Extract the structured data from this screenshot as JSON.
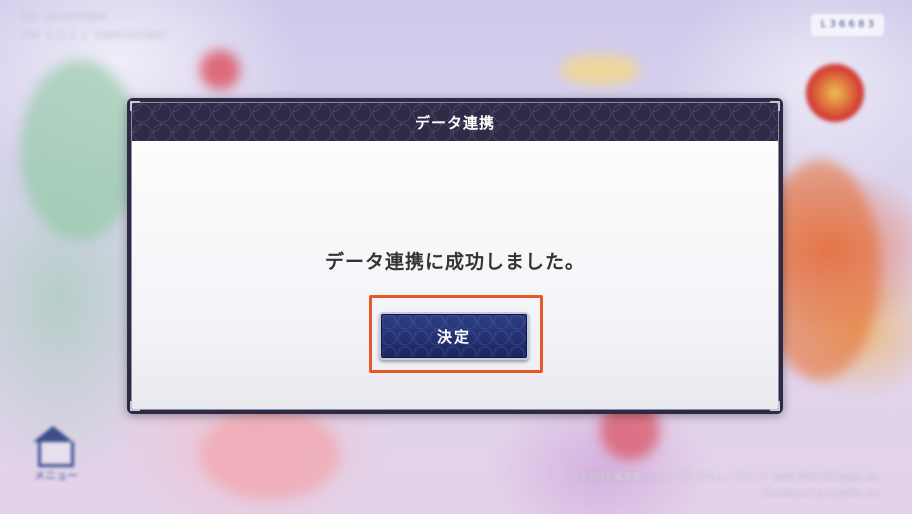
{
  "background": {
    "user_id": "ID: 6132078866",
    "version": "ver 1.2.1 / 118011211981",
    "top_right_button": "L 3 6 6 8 3",
    "menu_button_label": "メニュー",
    "copyright_lines": [
      "©2013 福井県 コナミ・ザ・アミューズメント 2020 1DO All Rights Inc.",
      "Developed by Appirits Inc."
    ]
  },
  "dialog": {
    "title": "データ連携",
    "message": "データ連携に成功しました。",
    "ok_button_label": "決定"
  },
  "colors": {
    "header_bg": "#2f2b46",
    "button_bg": "#1f2d6b",
    "highlight": "#e8572a",
    "message_text": "#333333"
  }
}
